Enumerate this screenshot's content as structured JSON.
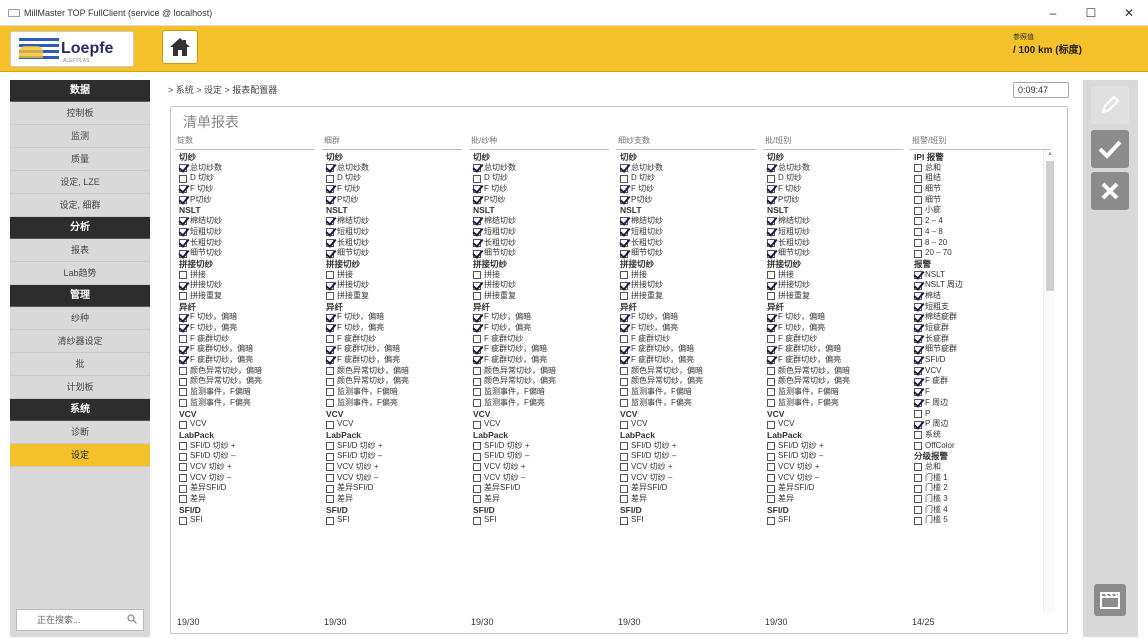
{
  "window": {
    "title": "MillMaster TOP FullClient (service @ localhost)",
    "minimize": "–",
    "maximize": "☐",
    "close": "✕"
  },
  "header": {
    "logo_text": "Loepfe",
    "logo_sub": "ALEFT/LAS",
    "info_label": "参照值",
    "info_value": "/ 100 km (标度)",
    "accent": "#f5c12a"
  },
  "sidebar": {
    "sections": [
      {
        "title": "数据",
        "items": [
          "控制板",
          "监测",
          "质量",
          "设定, LZE",
          "设定, 细群"
        ]
      },
      {
        "title": "分析",
        "items": [
          "报表",
          "Lab趋势"
        ]
      },
      {
        "title": "管理",
        "items": [
          "纱种",
          "清纱器设定",
          "批",
          "计划板"
        ]
      },
      {
        "title": "系统",
        "items": [
          "诊断",
          "设定"
        ]
      }
    ],
    "active": "设定",
    "search_placeholder": "正在搜索..."
  },
  "main": {
    "breadcrumb": "> 系统 > 设定 > 报表配置器",
    "timer": "0:09:47",
    "panel_title": "清单报表"
  },
  "columns": [
    {
      "header": "锭数",
      "footer": "19/30",
      "rows": [
        {
          "g": true,
          "t": "切纱"
        },
        {
          "c": true,
          "t": "总切纱数"
        },
        {
          "c": false,
          "t": "D 切纱"
        },
        {
          "c": true,
          "t": "F 切纱"
        },
        {
          "c": true,
          "t": "P切纱"
        },
        {
          "g": true,
          "t": "NSLT"
        },
        {
          "c": true,
          "t": "棉结切纱"
        },
        {
          "c": true,
          "t": "短粗切纱"
        },
        {
          "c": true,
          "t": "长粗切纱"
        },
        {
          "c": true,
          "t": "细节切纱"
        },
        {
          "g": true,
          "t": "拼接切纱"
        },
        {
          "c": false,
          "t": "拼接"
        },
        {
          "c": true,
          "t": "拼接切纱"
        },
        {
          "c": false,
          "t": "拼接重复"
        },
        {
          "g": true,
          "t": "异纤"
        },
        {
          "c": true,
          "t": "F 切纱，偏暗"
        },
        {
          "c": true,
          "t": "F 切纱，偏亮"
        },
        {
          "c": false,
          "t": "F 疵群切纱"
        },
        {
          "c": true,
          "t": "F 疵群切纱，偏暗"
        },
        {
          "c": true,
          "t": "F 疵群切纱，偏亮"
        },
        {
          "c": false,
          "t": "颜色异常切纱，偏暗"
        },
        {
          "c": false,
          "t": "颜色异常切纱，偏亮"
        },
        {
          "c": false,
          "t": "监测事件，F偏暗"
        },
        {
          "c": false,
          "t": "监测事件，F偏亮"
        },
        {
          "g": true,
          "t": "VCV"
        },
        {
          "c": false,
          "t": "VCV"
        },
        {
          "g": true,
          "t": "LabPack"
        },
        {
          "c": false,
          "t": "SFI/D 切纱 +"
        },
        {
          "c": false,
          "t": "SFI/D 切纱 –"
        },
        {
          "c": false,
          "t": "VCV 切纱 +"
        },
        {
          "c": false,
          "t": "VCV 切纱 –"
        },
        {
          "c": false,
          "t": "差异SFI/D"
        },
        {
          "c": false,
          "t": "差异"
        },
        {
          "g": true,
          "t": "SFI/D"
        },
        {
          "c": false,
          "t": "SFI"
        }
      ]
    },
    {
      "header": "细群",
      "footer": "19/30",
      "rows": [
        {
          "g": true,
          "t": "切纱"
        },
        {
          "c": true,
          "t": "总切纱数"
        },
        {
          "c": false,
          "t": "D 切纱"
        },
        {
          "c": true,
          "t": "F 切纱"
        },
        {
          "c": true,
          "t": "P切纱"
        },
        {
          "g": true,
          "t": "NSLT"
        },
        {
          "c": true,
          "t": "棉结切纱"
        },
        {
          "c": true,
          "t": "短粗切纱"
        },
        {
          "c": true,
          "t": "长粗切纱"
        },
        {
          "c": true,
          "t": "细节切纱"
        },
        {
          "g": true,
          "t": "拼接切纱"
        },
        {
          "c": false,
          "t": "拼接"
        },
        {
          "c": true,
          "t": "拼接切纱"
        },
        {
          "c": false,
          "t": "拼接重复"
        },
        {
          "g": true,
          "t": "异纤"
        },
        {
          "c": true,
          "t": "F 切纱，偏暗"
        },
        {
          "c": true,
          "t": "F 切纱，偏亮"
        },
        {
          "c": false,
          "t": "F 疵群切纱"
        },
        {
          "c": true,
          "t": "F 疵群切纱，偏暗"
        },
        {
          "c": true,
          "t": "F 疵群切纱，偏亮"
        },
        {
          "c": false,
          "t": "颜色异常切纱，偏暗"
        },
        {
          "c": false,
          "t": "颜色异常切纱，偏亮"
        },
        {
          "c": false,
          "t": "监测事件，F偏暗"
        },
        {
          "c": false,
          "t": "监测事件，F偏亮"
        },
        {
          "g": true,
          "t": "VCV"
        },
        {
          "c": false,
          "t": "VCV"
        },
        {
          "g": true,
          "t": "LabPack"
        },
        {
          "c": false,
          "t": "SFI/D 切纱 +"
        },
        {
          "c": false,
          "t": "SFI/D 切纱 –"
        },
        {
          "c": false,
          "t": "VCV 切纱 +"
        },
        {
          "c": false,
          "t": "VCV 切纱 –"
        },
        {
          "c": false,
          "t": "差异SFI/D"
        },
        {
          "c": false,
          "t": "差异"
        },
        {
          "g": true,
          "t": "SFI/D"
        },
        {
          "c": false,
          "t": "SFI"
        }
      ]
    },
    {
      "header": "批/纱种",
      "footer": "19/30",
      "rows": [
        {
          "g": true,
          "t": "切纱"
        },
        {
          "c": true,
          "t": "总切纱数"
        },
        {
          "c": false,
          "t": "D 切纱"
        },
        {
          "c": true,
          "t": "F 切纱"
        },
        {
          "c": true,
          "t": "P切纱"
        },
        {
          "g": true,
          "t": "NSLT"
        },
        {
          "c": true,
          "t": "棉结切纱"
        },
        {
          "c": true,
          "t": "短粗切纱"
        },
        {
          "c": true,
          "t": "长粗切纱"
        },
        {
          "c": true,
          "t": "细节切纱"
        },
        {
          "g": true,
          "t": "拼接切纱"
        },
        {
          "c": false,
          "t": "拼接"
        },
        {
          "c": true,
          "t": "拼接切纱"
        },
        {
          "c": false,
          "t": "拼接重复"
        },
        {
          "g": true,
          "t": "异纤"
        },
        {
          "c": true,
          "t": "F 切纱，偏暗"
        },
        {
          "c": true,
          "t": "F 切纱，偏亮"
        },
        {
          "c": false,
          "t": "F 疵群切纱"
        },
        {
          "c": true,
          "t": "F 疵群切纱，偏暗"
        },
        {
          "c": true,
          "t": "F 疵群切纱，偏亮"
        },
        {
          "c": false,
          "t": "颜色异常切纱，偏暗"
        },
        {
          "c": false,
          "t": "颜色异常切纱，偏亮"
        },
        {
          "c": false,
          "t": "监测事件，F偏暗"
        },
        {
          "c": false,
          "t": "监测事件，F偏亮"
        },
        {
          "g": true,
          "t": "VCV"
        },
        {
          "c": false,
          "t": "VCV"
        },
        {
          "g": true,
          "t": "LabPack"
        },
        {
          "c": false,
          "t": "SFI/D 切纱 +"
        },
        {
          "c": false,
          "t": "SFI/D 切纱 –"
        },
        {
          "c": false,
          "t": "VCV 切纱 +"
        },
        {
          "c": false,
          "t": "VCV 切纱 –"
        },
        {
          "c": false,
          "t": "差异SFI/D"
        },
        {
          "c": false,
          "t": "差异"
        },
        {
          "g": true,
          "t": "SFI/D"
        },
        {
          "c": false,
          "t": "SFI"
        }
      ]
    },
    {
      "header": "细纱支数",
      "footer": "19/30",
      "rows": [
        {
          "g": true,
          "t": "切纱"
        },
        {
          "c": true,
          "t": "总切纱数"
        },
        {
          "c": false,
          "t": "D 切纱"
        },
        {
          "c": true,
          "t": "F 切纱"
        },
        {
          "c": true,
          "t": "P切纱"
        },
        {
          "g": true,
          "t": "NSLT"
        },
        {
          "c": true,
          "t": "棉结切纱"
        },
        {
          "c": true,
          "t": "短粗切纱"
        },
        {
          "c": true,
          "t": "长粗切纱"
        },
        {
          "c": true,
          "t": "细节切纱"
        },
        {
          "g": true,
          "t": "拼接切纱"
        },
        {
          "c": false,
          "t": "拼接"
        },
        {
          "c": true,
          "t": "拼接切纱"
        },
        {
          "c": false,
          "t": "拼接重复"
        },
        {
          "g": true,
          "t": "异纤"
        },
        {
          "c": true,
          "t": "F 切纱，偏暗"
        },
        {
          "c": true,
          "t": "F 切纱，偏亮"
        },
        {
          "c": false,
          "t": "F 疵群切纱"
        },
        {
          "c": true,
          "t": "F 疵群切纱，偏暗"
        },
        {
          "c": true,
          "t": "F 疵群切纱，偏亮"
        },
        {
          "c": false,
          "t": "颜色异常切纱，偏暗"
        },
        {
          "c": false,
          "t": "颜色异常切纱，偏亮"
        },
        {
          "c": false,
          "t": "监测事件，F偏暗"
        },
        {
          "c": false,
          "t": "监测事件，F偏亮"
        },
        {
          "g": true,
          "t": "VCV"
        },
        {
          "c": false,
          "t": "VCV"
        },
        {
          "g": true,
          "t": "LabPack"
        },
        {
          "c": false,
          "t": "SFI/D 切纱 +"
        },
        {
          "c": false,
          "t": "SFI/D 切纱 –"
        },
        {
          "c": false,
          "t": "VCV 切纱 +"
        },
        {
          "c": false,
          "t": "VCV 切纱 –"
        },
        {
          "c": false,
          "t": "差异SFI/D"
        },
        {
          "c": false,
          "t": "差异"
        },
        {
          "g": true,
          "t": "SFI/D"
        },
        {
          "c": false,
          "t": "SFI"
        }
      ]
    },
    {
      "header": "批/班别",
      "footer": "19/30",
      "rows": [
        {
          "g": true,
          "t": "切纱"
        },
        {
          "c": true,
          "t": "总切纱数"
        },
        {
          "c": false,
          "t": "D 切纱"
        },
        {
          "c": true,
          "t": "F 切纱"
        },
        {
          "c": true,
          "t": "P切纱"
        },
        {
          "g": true,
          "t": "NSLT"
        },
        {
          "c": true,
          "t": "棉结切纱"
        },
        {
          "c": true,
          "t": "短粗切纱"
        },
        {
          "c": true,
          "t": "长粗切纱"
        },
        {
          "c": true,
          "t": "细节切纱"
        },
        {
          "g": true,
          "t": "拼接切纱"
        },
        {
          "c": false,
          "t": "拼接"
        },
        {
          "c": true,
          "t": "拼接切纱"
        },
        {
          "c": false,
          "t": "拼接重复"
        },
        {
          "g": true,
          "t": "异纤"
        },
        {
          "c": true,
          "t": "F 切纱，偏暗"
        },
        {
          "c": true,
          "t": "F 切纱，偏亮"
        },
        {
          "c": false,
          "t": "F 疵群切纱"
        },
        {
          "c": true,
          "t": "F 疵群切纱，偏暗"
        },
        {
          "c": true,
          "t": "F 疵群切纱，偏亮"
        },
        {
          "c": false,
          "t": "颜色异常切纱，偏暗"
        },
        {
          "c": false,
          "t": "颜色异常切纱，偏亮"
        },
        {
          "c": false,
          "t": "监测事件，F偏暗"
        },
        {
          "c": false,
          "t": "监测事件，F偏亮"
        },
        {
          "g": true,
          "t": "VCV"
        },
        {
          "c": false,
          "t": "VCV"
        },
        {
          "g": true,
          "t": "LabPack"
        },
        {
          "c": false,
          "t": "SFI/D 切纱 +"
        },
        {
          "c": false,
          "t": "SFI/D 切纱 –"
        },
        {
          "c": false,
          "t": "VCV 切纱 +"
        },
        {
          "c": false,
          "t": "VCV 切纱 –"
        },
        {
          "c": false,
          "t": "差异SFI/D"
        },
        {
          "c": false,
          "t": "差异"
        },
        {
          "g": true,
          "t": "SFI/D"
        },
        {
          "c": false,
          "t": "SFI"
        }
      ]
    },
    {
      "header": "报警/班别",
      "footer": "14/25",
      "rows": [
        {
          "g": true,
          "t": "IPI 报警"
        },
        {
          "c": false,
          "t": "总和"
        },
        {
          "c": false,
          "t": "粗结"
        },
        {
          "c": false,
          "t": "细节"
        },
        {
          "c": false,
          "t": "细节"
        },
        {
          "c": false,
          "t": "小疵"
        },
        {
          "c": false,
          "t": "2 – 4"
        },
        {
          "c": false,
          "t": "4 – 8"
        },
        {
          "c": false,
          "t": "8 – 20"
        },
        {
          "c": false,
          "t": "20 – 70"
        },
        {
          "g": true,
          "t": "报警"
        },
        {
          "c": true,
          "t": "NSLT"
        },
        {
          "c": true,
          "t": "NSLT 周边"
        },
        {
          "c": true,
          "t": "棉结"
        },
        {
          "c": true,
          "t": "短粗支"
        },
        {
          "c": true,
          "t": "棉结疵群"
        },
        {
          "c": true,
          "t": "短疵群"
        },
        {
          "c": true,
          "t": "长疵群"
        },
        {
          "c": true,
          "t": "细节疵群"
        },
        {
          "c": true,
          "t": "SFI/D"
        },
        {
          "c": true,
          "t": "VCV"
        },
        {
          "c": true,
          "t": "F 疵群"
        },
        {
          "c": true,
          "t": "F"
        },
        {
          "c": true,
          "t": "F 周边"
        },
        {
          "c": false,
          "t": "P"
        },
        {
          "c": true,
          "t": "P 周边"
        },
        {
          "c": false,
          "t": "系统"
        },
        {
          "c": false,
          "t": "OffColor"
        },
        {
          "g": true,
          "t": "分级报警"
        },
        {
          "c": false,
          "t": "总和"
        },
        {
          "c": false,
          "t": "门槛 1"
        },
        {
          "c": false,
          "t": "门槛 2"
        },
        {
          "c": false,
          "t": "门槛 3"
        },
        {
          "c": false,
          "t": "门槛 4"
        },
        {
          "c": false,
          "t": "门槛 5"
        }
      ]
    }
  ],
  "actions": {
    "edit_icon": "pencil-icon",
    "ok_icon": "check-icon",
    "cancel_icon": "close-icon",
    "export_icon": "clapper-icon"
  }
}
